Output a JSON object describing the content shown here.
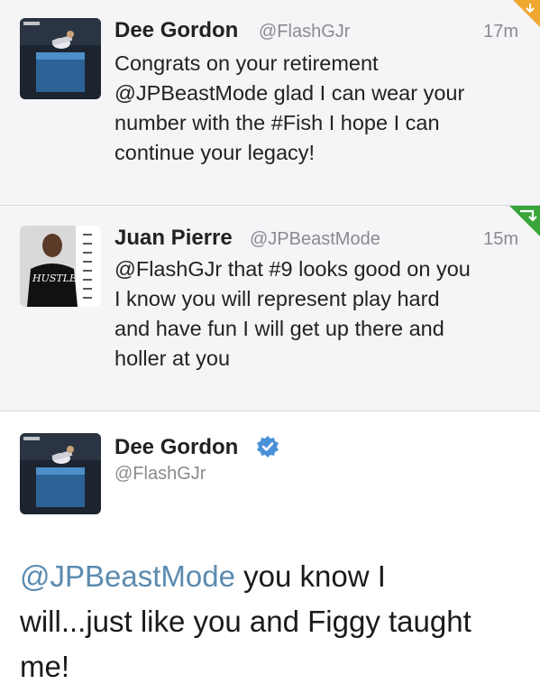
{
  "tweets": [
    {
      "name": "Dee Gordon",
      "handle": "@FlashGJr",
      "time": "17m",
      "lines": [
        "Congrats on your retirement",
        "@JPBeastMode glad I can wear your",
        "number with the #Fish I hope I can",
        "continue your legacy!"
      ],
      "corner_icon": "retweet-corner-orange-icon",
      "corner_color": "#f0a830"
    },
    {
      "name": "Juan Pierre",
      "handle": "@JPBeastMode",
      "time": "15m",
      "lines": [
        "@FlashGJr that #9 looks good on you",
        "I know you will represent play hard",
        "and have fun I  will get up there and",
        "holler at you"
      ],
      "corner_icon": "retweet-corner-green-icon",
      "corner_color": "#3aa63a",
      "avatar_shirt_text": "HUSTLE"
    },
    {
      "name": "Dee Gordon",
      "handle": "@FlashGJr",
      "verified_icon": "verified-badge-icon",
      "mention": "@JPBeastMode",
      "line1_rest": " you know I",
      "line2": "will...just like you and Figgy taught",
      "line3": "me!"
    }
  ],
  "colors": {
    "verified": "#4a90d9",
    "mention": "#5b8bb0",
    "muted": "#8a8a8f"
  }
}
